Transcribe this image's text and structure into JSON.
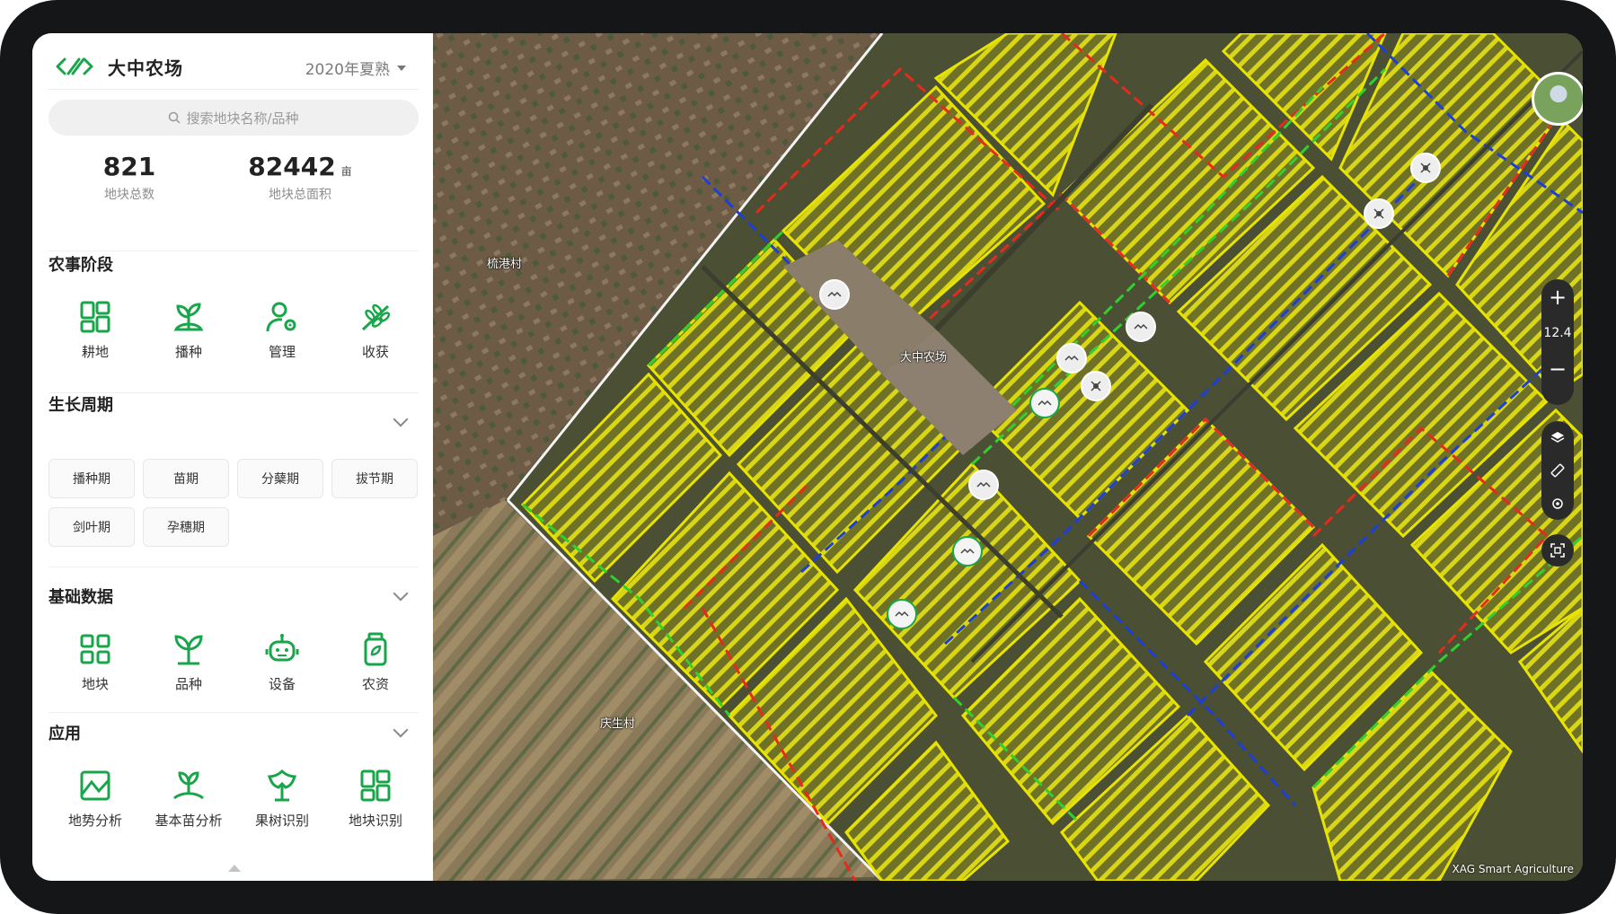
{
  "header": {
    "title": "大中农场",
    "season": "2020年夏熟"
  },
  "search": {
    "placeholder": "搜索地块名称/品种"
  },
  "stats": {
    "plot_count": "821",
    "plot_count_label": "地块总数",
    "area": "82442",
    "area_unit": "亩",
    "area_label": "地块总面积"
  },
  "farming_stage": {
    "title": "农事阶段",
    "items": [
      {
        "label": "耕地",
        "icon": "field-grid-icon"
      },
      {
        "label": "播种",
        "icon": "seedling-plant-icon"
      },
      {
        "label": "管理",
        "icon": "user-gear-icon"
      },
      {
        "label": "收获",
        "icon": "wheat-harvest-icon"
      }
    ]
  },
  "growth_cycle": {
    "title": "生长周期",
    "chips": [
      "播种期",
      "苗期",
      "分蘖期",
      "拔节期",
      "剑叶期",
      "孕穗期"
    ]
  },
  "basic_data": {
    "title": "基础数据",
    "items": [
      {
        "label": "地块",
        "icon": "plots-grid-icon"
      },
      {
        "label": "品种",
        "icon": "sprout-icon"
      },
      {
        "label": "设备",
        "icon": "robot-icon"
      },
      {
        "label": "农资",
        "icon": "supplies-jar-icon"
      }
    ]
  },
  "applications": {
    "title": "应用",
    "items": [
      {
        "label": "地势分析",
        "icon": "terrain-icon"
      },
      {
        "label": "基本苗分析",
        "icon": "seedling-analysis-icon"
      },
      {
        "label": "果树识别",
        "icon": "tree-icon"
      },
      {
        "label": "地块识别",
        "icon": "plot-recognition-icon"
      }
    ]
  },
  "map": {
    "zoom_level": "12.4",
    "zoom_in": "+",
    "zoom_out": "−",
    "labels": {
      "village_1": "梳港村",
      "farm": "大中农场",
      "village_2": "庆生村"
    },
    "copyright": "XAG Smart Agriculture"
  },
  "colors": {
    "brand_green": "#19a64a",
    "field_yellow": "#e8e400",
    "boundary_red": "#e52b1e",
    "boundary_blue": "#1c3fd6",
    "boundary_green": "#2fd02f"
  }
}
